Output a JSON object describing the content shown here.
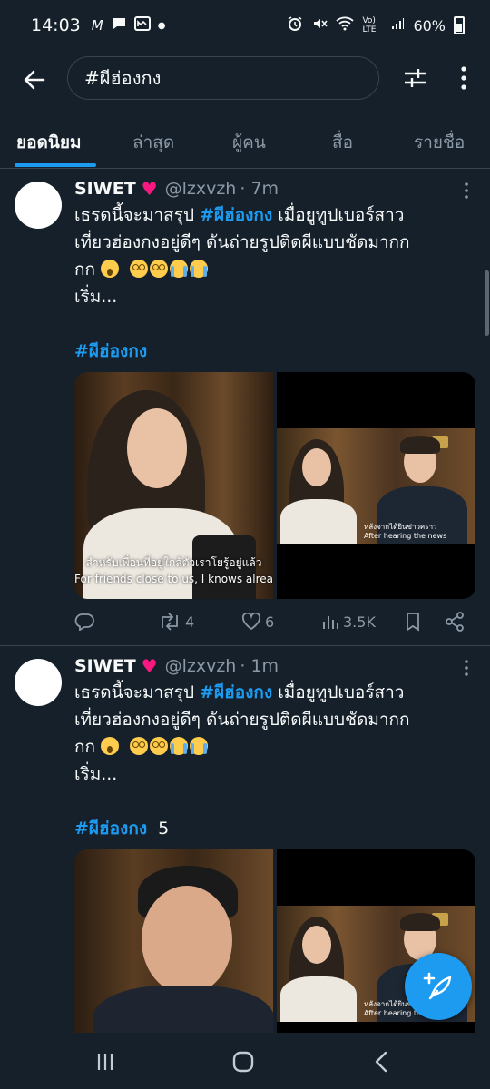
{
  "status_bar": {
    "time": "14:03",
    "notif_icons": [
      "M",
      "chat-bubble",
      "mail-app",
      "•"
    ],
    "network_label": "Vo) LTE",
    "battery": "60%"
  },
  "search": {
    "query": "#ผีฮ่องกง"
  },
  "tabs": [
    {
      "label": "ยอดนิยม",
      "active": true
    },
    {
      "label": "ล่าสุด",
      "active": false
    },
    {
      "label": "ผู้คน",
      "active": false
    },
    {
      "label": "สื่อ",
      "active": false
    },
    {
      "label": "รายชื่อ",
      "active": false
    }
  ],
  "tweets": [
    {
      "name": "SIWET",
      "heart": "♥",
      "handle": "@lzxvzh",
      "time": "· 7m",
      "text_prefix": "เธรดนี้จะมาสรุป ",
      "text_hashtag": "#ผีฮ่องกง",
      "text_rest_1": " เมื่อยูทูปเบอร์สาว",
      "text_line2": "เที่ยวฮ่องกงอยู่ดีๆ ดันถ่ายรูปติดผีแบบชัดมากก",
      "text_line3": "กก",
      "text_line4": "เริ่ม...",
      "tag": "#ผีฮ่องกง",
      "tag_count": "",
      "media": {
        "left_subtitle_th": "สำหรับเพื่อนที่อยู่ใกล้ตัวเราโยรู้อยู่แล้ว",
        "left_subtitle_en": "For friends close to us, I knows already",
        "right_subtitle_th": "หลังจากได้ยินข่าวคราว",
        "right_subtitle_en": "After hearing the news"
      },
      "actions": {
        "reply": "",
        "retweet": "4",
        "like": "6",
        "views": "3.5K"
      }
    },
    {
      "name": "SIWET",
      "heart": "♥",
      "handle": "@lzxvzh",
      "time": "· 1m",
      "text_prefix": "เธรดนี้จะมาสรุป ",
      "text_hashtag": "#ผีฮ่องกง",
      "text_rest_1": " เมื่อยูทูปเบอร์สาว",
      "text_line2": "เที่ยวฮ่องกงอยู่ดีๆ ดันถ่ายรูปติดผีแบบชัดมากก",
      "text_line3": "กก",
      "text_line4": "เริ่ม...",
      "tag": "#ผีฮ่องกง",
      "tag_count": "5",
      "media": {
        "right_subtitle_th": "หลังจากได้ยินข่าวคราว",
        "right_subtitle_en": "After hearing the news"
      }
    }
  ],
  "colors": {
    "background": "#15202b",
    "accent": "#1d9bf0",
    "muted": "#8b98a5",
    "heart": "#f91880"
  }
}
